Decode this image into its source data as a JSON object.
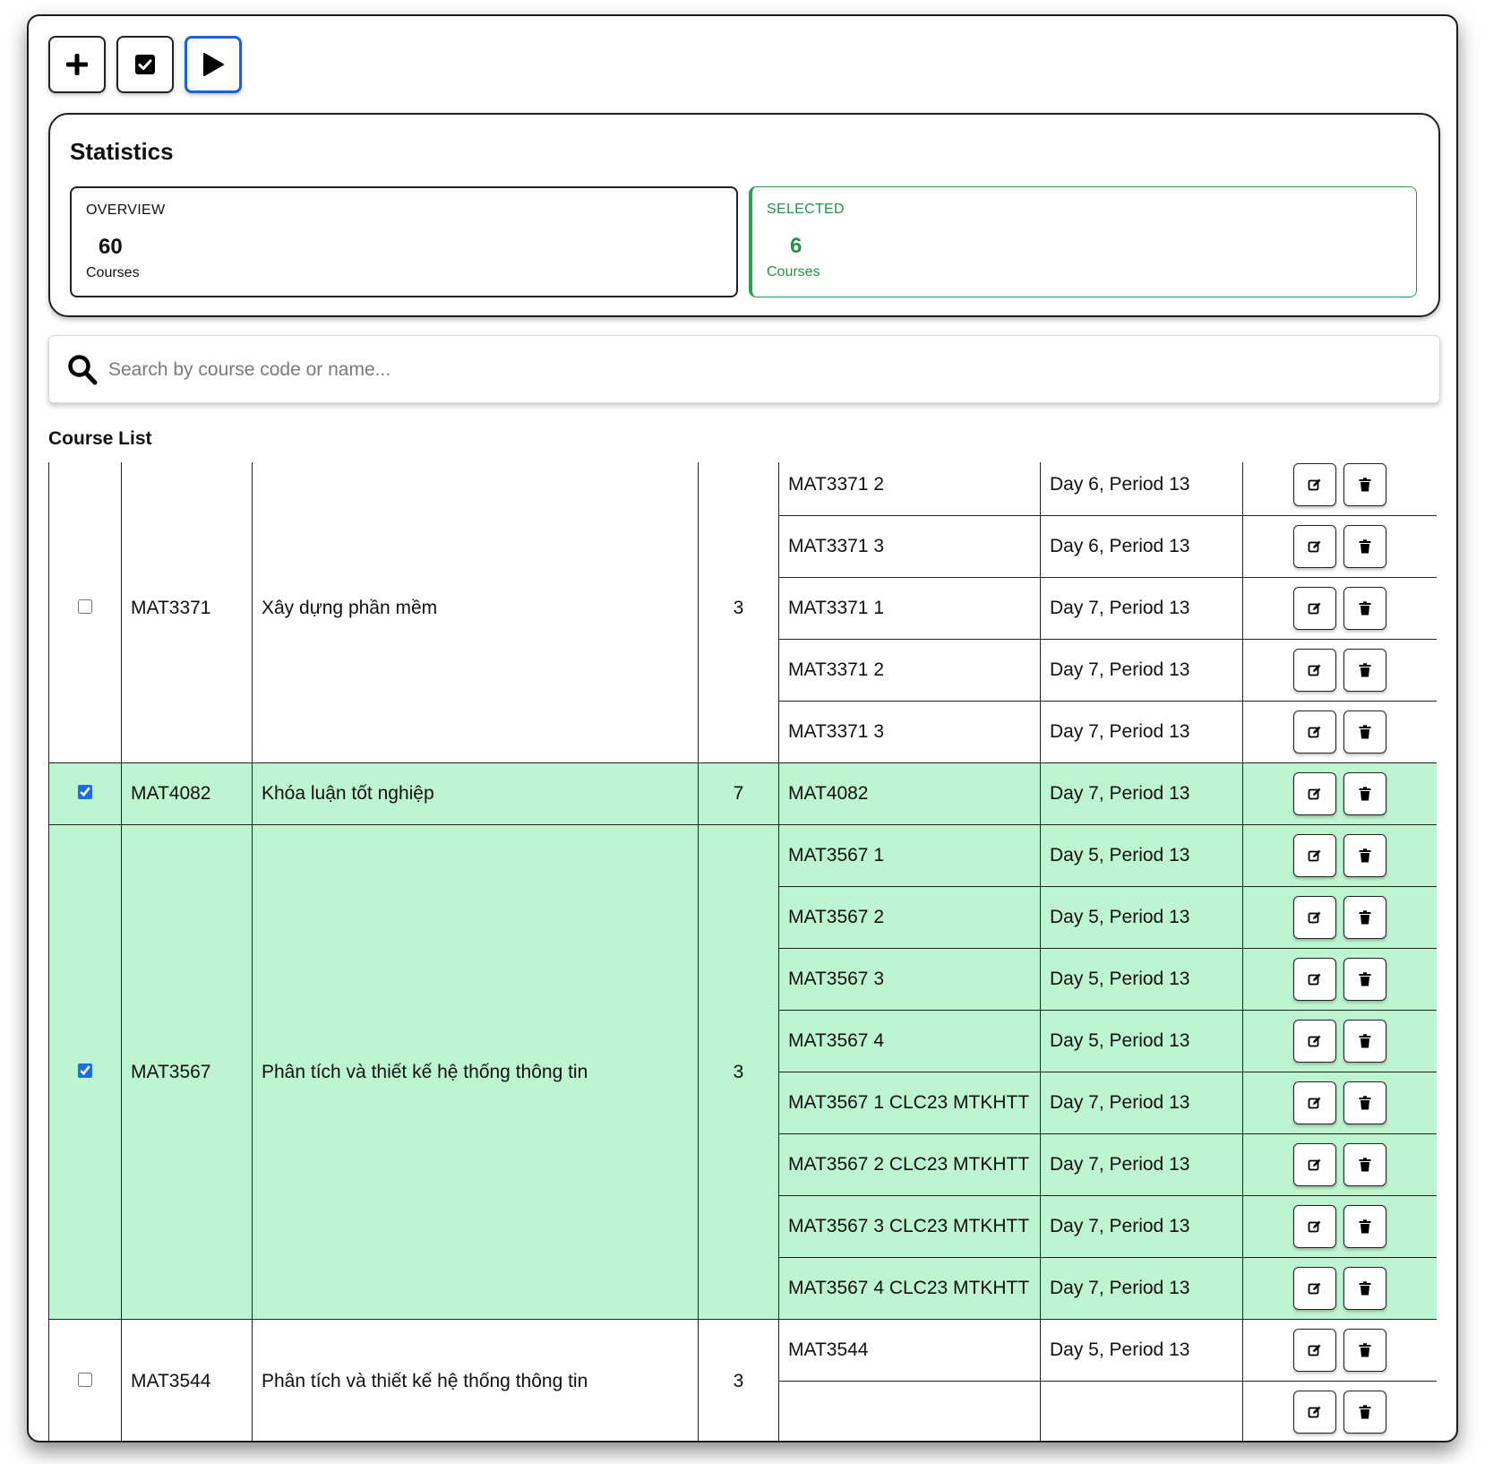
{
  "toolbar": {
    "buttons": [
      {
        "name": "add",
        "icon": "plus-icon"
      },
      {
        "name": "select-all",
        "icon": "checkbox-checked-icon"
      },
      {
        "name": "run",
        "icon": "play-icon",
        "active": true
      }
    ]
  },
  "statistics": {
    "title": "Statistics",
    "overview": {
      "label": "OVERVIEW",
      "value": "60",
      "unit": "Courses"
    },
    "selected": {
      "label": "SELECTED",
      "value": "6",
      "unit": "Courses",
      "color": "#24944a"
    }
  },
  "search": {
    "placeholder": "Search by course code or name...",
    "value": "",
    "icon": "search-icon"
  },
  "course_list": {
    "title": "Course List",
    "selected_row_color": "#bef5d1",
    "courses": [
      {
        "checked": false,
        "code": "MAT3371",
        "name": "Xây dựng phần mềm",
        "credits": "3",
        "classes": [
          {
            "name": "MAT3371 2",
            "schedule": "Day 6, Period 13"
          },
          {
            "name": "MAT3371 3",
            "schedule": "Day 6, Period 13"
          },
          {
            "name": "MAT3371 1",
            "schedule": "Day 7, Period 13"
          },
          {
            "name": "MAT3371 2",
            "schedule": "Day 7, Period 13"
          },
          {
            "name": "MAT3371 3",
            "schedule": "Day 7, Period 13"
          }
        ]
      },
      {
        "checked": true,
        "code": "MAT4082",
        "name": "Khóa luận tốt nghiệp",
        "credits": "7",
        "classes": [
          {
            "name": "MAT4082",
            "schedule": "Day 7, Period 13"
          }
        ]
      },
      {
        "checked": true,
        "code": "MAT3567",
        "name": "Phân tích và thiết kế hệ thống thông tin",
        "credits": "3",
        "classes": [
          {
            "name": "MAT3567 1",
            "schedule": "Day 5, Period 13"
          },
          {
            "name": "MAT3567 2",
            "schedule": "Day 5, Period 13"
          },
          {
            "name": "MAT3567 3",
            "schedule": "Day 5, Period 13"
          },
          {
            "name": "MAT3567 4",
            "schedule": "Day 5, Period 13"
          },
          {
            "name": "MAT3567 1 CLC23 MTKHTT",
            "schedule": "Day 7, Period 13"
          },
          {
            "name": "MAT3567 2 CLC23 MTKHTT",
            "schedule": "Day 7, Period 13"
          },
          {
            "name": "MAT3567 3 CLC23 MTKHTT",
            "schedule": "Day 7, Period 13"
          },
          {
            "name": "MAT3567 4 CLC23 MTKHTT",
            "schedule": "Day 7, Period 13"
          }
        ]
      },
      {
        "checked": false,
        "code": "MAT3544",
        "name": "Phân tích và thiết kế hệ thống thông tin",
        "credits": "3",
        "classes": [
          {
            "name": "MAT3544",
            "schedule": "Day 5, Period 13"
          },
          {
            "name": "",
            "schedule": ""
          }
        ]
      }
    ],
    "row_action_icons": [
      "edit-icon",
      "trash-icon"
    ]
  }
}
